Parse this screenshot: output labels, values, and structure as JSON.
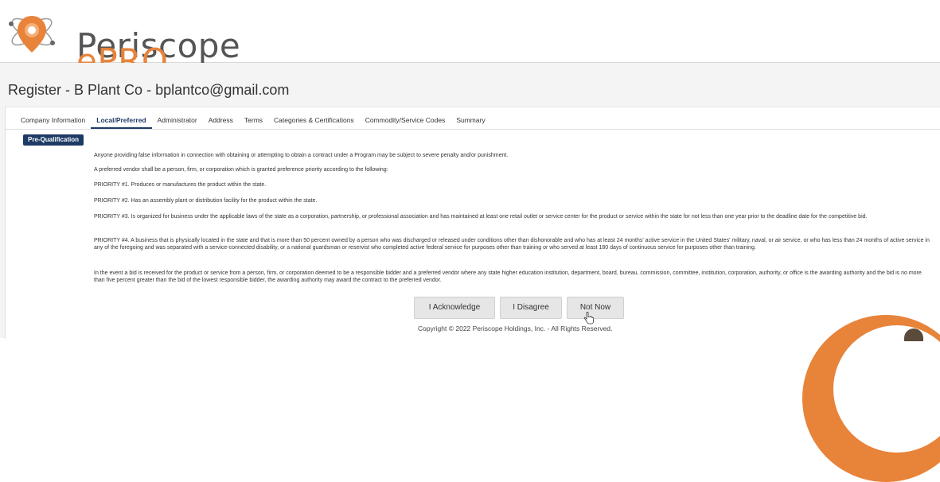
{
  "brand": {
    "name_part1": "Periscope",
    "name_part2": "ePRO",
    "accent_color": "#e8833a",
    "primary_color": "#1e3b66"
  },
  "page": {
    "title": "Register - B Plant Co - bplantco@gmail.com"
  },
  "tabs": [
    {
      "label": "Company Information",
      "active": false
    },
    {
      "label": "Local/Preferred",
      "active": true
    },
    {
      "label": "Administrator",
      "active": false
    },
    {
      "label": "Address",
      "active": false
    },
    {
      "label": "Terms",
      "active": false
    },
    {
      "label": "Categories & Certifications",
      "active": false
    },
    {
      "label": "Commodity/Service Codes",
      "active": false
    },
    {
      "label": "Summary",
      "active": false
    }
  ],
  "section": {
    "badge": "Pre-Qualification"
  },
  "paragraphs": [
    "Anyone providing false information in connection with obtaining or attempting to obtain a contract under a Program may be subject to severe penalty and/or punishment.",
    "A preferred vendor shall be a person, firm, or corporation which is granted preference priority according to the following:",
    "PRIORITY #1. Produces or manufactures the product within the state.",
    "PRIORITY #2. Has an assembly plant or distribution facility for the product within the state.",
    "PRIORITY #3. Is organized for business under the applicable laws of the state as a corporation, partnership, or professional association and has maintained at least one retail outlet or service center for the product or service within the state for not less than one year prior to the deadline date for the competitive bid.",
    "PRIORITY #4. A business that is physically located in the state and that is more than 50 percent owned by a person who was discharged or released under conditions other than dishonorable and who has at least 24 months' active service in the United States' military, naval, or air service, or who has less than 24 months of active service in any of the foregoing and was separated with a service-connected disability, or a national guardsman or reservist who completed active federal service for purposes other than training or who served at least 180 days of continuous service for purposes other than training.",
    "In the event a bid is received for the product or service from a person, firm, or corporation deemed to be a responsible bidder and a preferred vendor where any state higher education institution, department, board, bureau, commission, committee, institution, corporation, authority, or office is the awarding authority and the bid is no more than five percent greater than the bid of the lowest responsible bidder, the awarding authority may award the contract to the preferred vendor."
  ],
  "buttons": {
    "acknowledge": "I Acknowledge",
    "disagree": "I Disagree",
    "not_now": "Not Now"
  },
  "footer": {
    "copyright": "Copyright © 2022 Periscope Holdings, Inc. - All Rights Reserved."
  },
  "icons": {
    "logo": "periscope-atom-logo-icon",
    "cursor": "hand-pointer-icon"
  }
}
